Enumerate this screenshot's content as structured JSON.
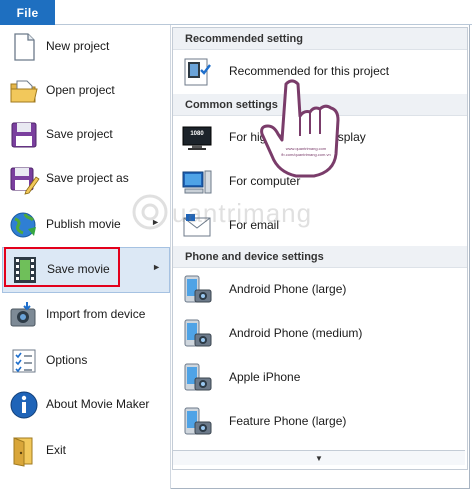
{
  "ribbon": {
    "file_tab": "File"
  },
  "left_menu": {
    "items": [
      {
        "label": "New project",
        "icon": "new-project-icon"
      },
      {
        "label": "Open project",
        "icon": "open-project-icon"
      },
      {
        "label": "Save project",
        "icon": "save-project-icon"
      },
      {
        "label": "Save project as",
        "icon": "save-project-as-icon"
      },
      {
        "label": "Publish movie",
        "icon": "publish-movie-icon",
        "has_submenu": true
      },
      {
        "label": "Save movie",
        "icon": "save-movie-icon",
        "has_submenu": true,
        "selected": true
      },
      {
        "label": "Import from device",
        "icon": "import-device-icon"
      },
      {
        "label": "Options",
        "icon": "options-icon"
      },
      {
        "label": "About Movie Maker",
        "icon": "about-icon"
      },
      {
        "label": "Exit",
        "icon": "exit-icon"
      }
    ],
    "submenu_arrow": "►"
  },
  "submenu": {
    "sections": [
      {
        "heading": "Recommended setting",
        "items": [
          {
            "label": "Recommended for this project",
            "icon": "recommended-icon"
          }
        ]
      },
      {
        "heading": "Common settings",
        "items": [
          {
            "label": "For high-definition display",
            "icon": "hd-display-icon",
            "badge": "1080"
          },
          {
            "label": "For computer",
            "icon": "computer-icon"
          },
          {
            "label": "For email",
            "icon": "email-icon"
          }
        ]
      },
      {
        "heading": "Phone and device settings",
        "items": [
          {
            "label": "Android Phone (large)",
            "icon": "android-phone-icon"
          },
          {
            "label": "Android Phone (medium)",
            "icon": "android-phone-icon"
          },
          {
            "label": "Apple iPhone",
            "icon": "iphone-icon"
          },
          {
            "label": "Feature Phone (large)",
            "icon": "feature-phone-icon"
          }
        ]
      }
    ],
    "scroll_glyph": "▼"
  },
  "overlay": {
    "watermark_text": "uantrimang",
    "hand_caption_1": "www.quantrimang.com",
    "hand_caption_2": "fb.com/quantrimang.com.vn"
  },
  "colors": {
    "file_tab": "#1e6fc0",
    "selection": "#dce8f5",
    "highlight_box": "#e3001b",
    "hand": "#7a3c6a"
  }
}
